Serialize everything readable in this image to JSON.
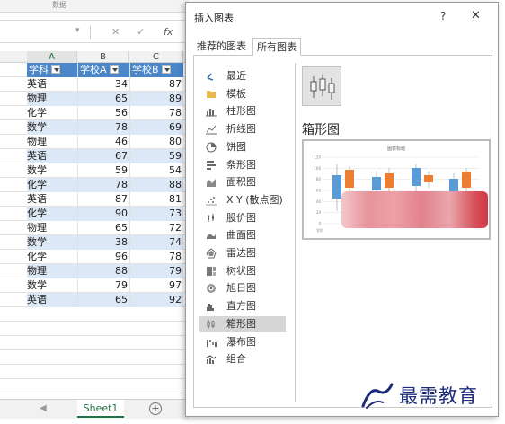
{
  "excel": {
    "ribbon_group": "数据",
    "formula_bar": {
      "cancel": "✕",
      "confirm": "✓",
      "fx": "fx"
    },
    "columns": [
      "A",
      "B",
      "C"
    ],
    "headers": [
      "学科",
      "学校A",
      "学校B"
    ],
    "rows": [
      [
        "英语",
        "34",
        "87"
      ],
      [
        "物理",
        "65",
        "89"
      ],
      [
        "化学",
        "56",
        "78"
      ],
      [
        "数学",
        "78",
        "69"
      ],
      [
        "物理",
        "46",
        "80"
      ],
      [
        "英语",
        "67",
        "59"
      ],
      [
        "数学",
        "59",
        "54"
      ],
      [
        "化学",
        "78",
        "88"
      ],
      [
        "英语",
        "87",
        "81"
      ],
      [
        "化学",
        "90",
        "73"
      ],
      [
        "物理",
        "65",
        "72"
      ],
      [
        "数学",
        "38",
        "74"
      ],
      [
        "化学",
        "96",
        "78"
      ],
      [
        "物理",
        "88",
        "79"
      ],
      [
        "数学",
        "79",
        "97"
      ],
      [
        "英语",
        "65",
        "92"
      ]
    ],
    "sheet_tab": "Sheet1",
    "add_sheet": "+",
    "nav_arrow": "◀"
  },
  "dialog": {
    "title": "插入图表",
    "help": "?",
    "close": "✕",
    "tabs": [
      "推荐的图表",
      "所有图表"
    ],
    "active_tab": "所有图表",
    "chart_types": [
      {
        "label": "最近",
        "icon": "recent-icon"
      },
      {
        "label": "模板",
        "icon": "folder-icon"
      },
      {
        "label": "柱形图",
        "icon": "column-chart-icon"
      },
      {
        "label": "折线图",
        "icon": "line-chart-icon"
      },
      {
        "label": "饼图",
        "icon": "pie-chart-icon"
      },
      {
        "label": "条形图",
        "icon": "bar-chart-icon"
      },
      {
        "label": "面积图",
        "icon": "area-chart-icon"
      },
      {
        "label": "X Y (散点图)",
        "icon": "scatter-chart-icon"
      },
      {
        "label": "股价图",
        "icon": "stock-chart-icon"
      },
      {
        "label": "曲面图",
        "icon": "surface-chart-icon"
      },
      {
        "label": "雷达图",
        "icon": "radar-chart-icon"
      },
      {
        "label": "树状图",
        "icon": "treemap-chart-icon"
      },
      {
        "label": "旭日图",
        "icon": "sunburst-chart-icon"
      },
      {
        "label": "直方图",
        "icon": "histogram-chart-icon"
      },
      {
        "label": "箱形图",
        "icon": "box-whisker-chart-icon"
      },
      {
        "label": "瀑布图",
        "icon": "waterfall-chart-icon"
      },
      {
        "label": "组合",
        "icon": "combo-chart-icon"
      }
    ],
    "selected_type": "箱形图",
    "preview": {
      "title": "箱形图",
      "chart_title": "图表标题",
      "y_ticks": [
        "120",
        "100",
        "80",
        "60",
        "40",
        "20",
        "0"
      ],
      "x_label": "学科"
    }
  },
  "watermark": {
    "text": "最需教育"
  },
  "colors": {
    "header_blue": "#4a86c8",
    "band_blue": "#dce8f5",
    "series_blue": "#5b9bd5",
    "series_orange": "#ed7d31",
    "selected_gray": "#d6d6d6",
    "watermark": "#1d2c7a"
  }
}
